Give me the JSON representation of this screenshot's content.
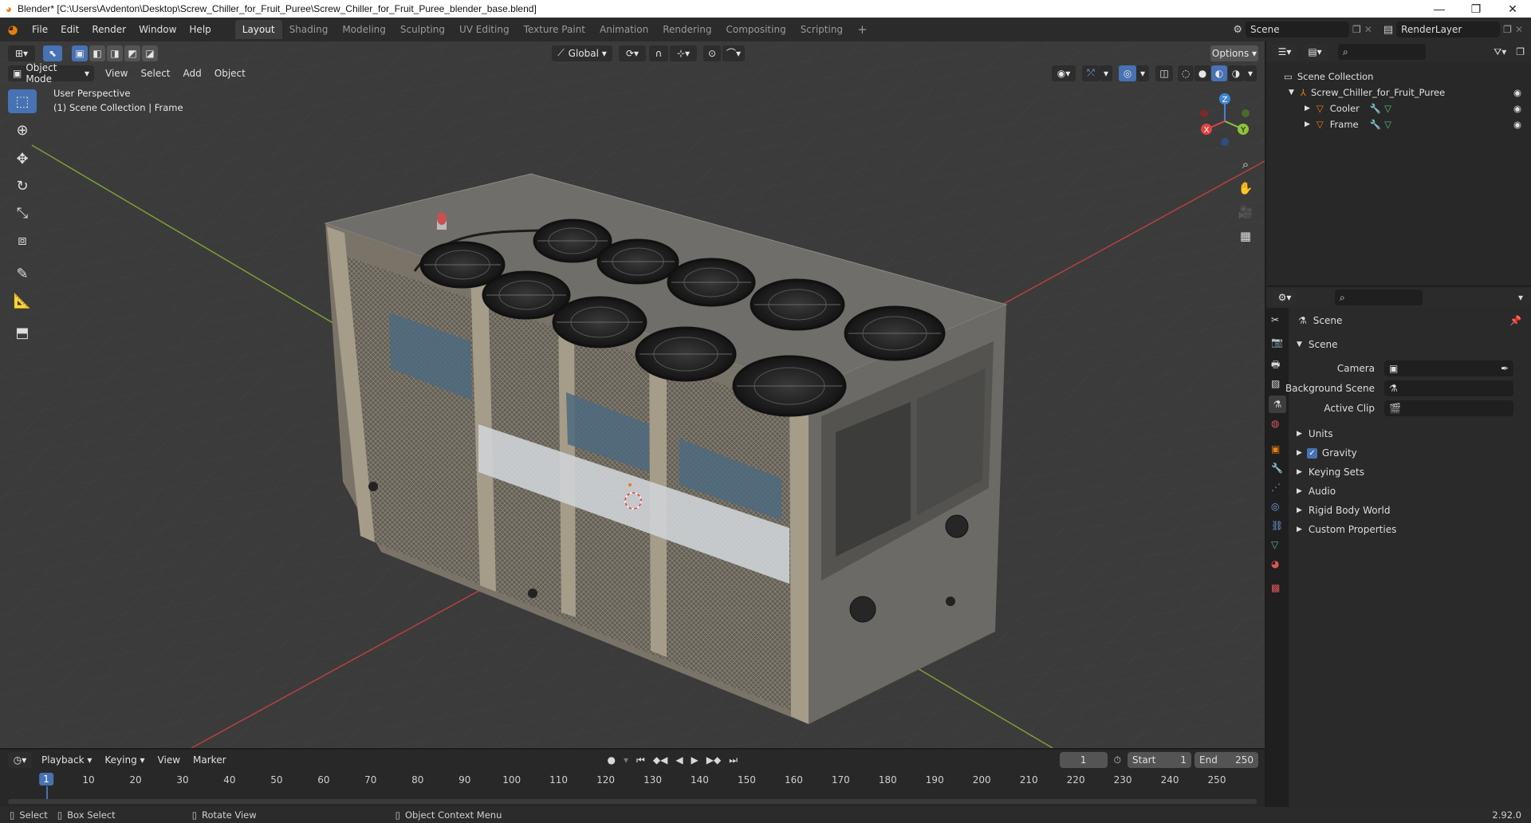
{
  "window": {
    "title": "Blender* [C:\\Users\\Avdenton\\Desktop\\Screw_Chiller_for_Fruit_Puree\\Screw_Chiller_for_Fruit_Puree_blender_base.blend]",
    "minimize": "—",
    "maximize": "❐",
    "close": "✕"
  },
  "menu": [
    "File",
    "Edit",
    "Render",
    "Window",
    "Help"
  ],
  "workspaces": {
    "tabs": [
      "Layout",
      "Shading",
      "Modeling",
      "Sculpting",
      "UV Editing",
      "Texture Paint",
      "Animation",
      "Rendering",
      "Compositing",
      "Scripting"
    ],
    "active": "Layout",
    "add": "+"
  },
  "scene": {
    "name": "Scene",
    "render_layer": "RenderLayer"
  },
  "viewport": {
    "transform_orientation": "Global",
    "options_label": "Options",
    "mode": "Object Mode",
    "menus": [
      "View",
      "Select",
      "Add",
      "Object"
    ],
    "overlay_line1": "User Perspective",
    "overlay_line2": "(1) Scene Collection | Frame",
    "gizmo": {
      "z": "Z",
      "y": "Y",
      "x": "X"
    }
  },
  "outliner": {
    "root": "Scene Collection",
    "items": [
      {
        "name": "Screw_Chiller_for_Fruit_Puree",
        "level": 1
      },
      {
        "name": "Cooler",
        "level": 2
      },
      {
        "name": "Frame",
        "level": 2
      }
    ]
  },
  "properties": {
    "context": "Scene",
    "panel": "Scene",
    "fields": [
      {
        "label": "Camera",
        "value": ""
      },
      {
        "label": "Background Scene",
        "value": ""
      },
      {
        "label": "Active Clip",
        "value": ""
      }
    ],
    "sections": [
      "Units",
      "Gravity",
      "Keying Sets",
      "Audio",
      "Rigid Body World",
      "Custom Properties"
    ],
    "gravity_checked": true
  },
  "timeline": {
    "menus": [
      "Playback",
      "Keying",
      "View",
      "Marker"
    ],
    "current_frame": "1",
    "start_label": "Start",
    "start": "1",
    "end_label": "End",
    "end": "250",
    "ticks": [
      "1",
      "10",
      "20",
      "30",
      "40",
      "50",
      "60",
      "70",
      "80",
      "90",
      "100",
      "110",
      "120",
      "130",
      "140",
      "150",
      "160",
      "170",
      "180",
      "190",
      "200",
      "210",
      "220",
      "230",
      "240",
      "250"
    ]
  },
  "status": {
    "select": "Select",
    "box_select": "Box Select",
    "rotate": "Rotate View",
    "context_menu": "Object Context Menu",
    "version": "2.92.0"
  },
  "colors": {
    "accent": "#4772b3",
    "axis_x": "#e04444",
    "axis_y": "#8fc43a",
    "axis_z": "#3e87d4",
    "orange": "#e87d0d"
  }
}
